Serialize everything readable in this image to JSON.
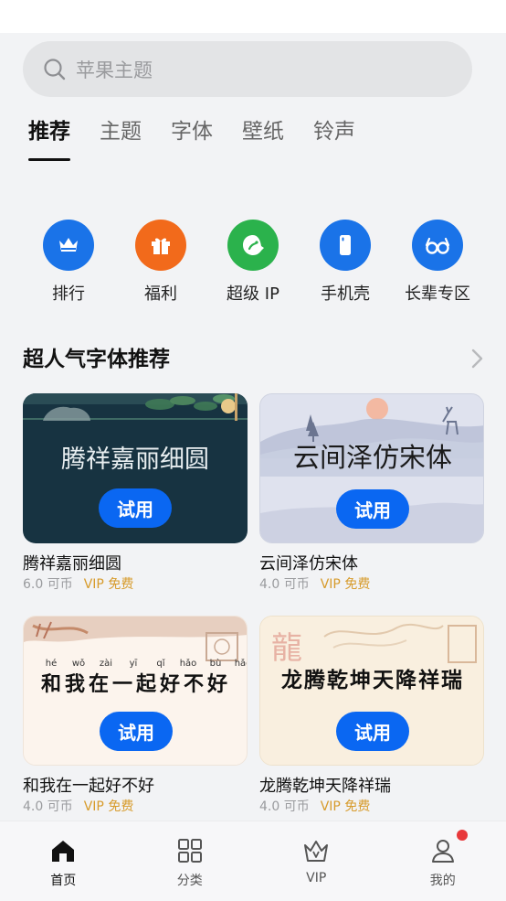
{
  "search": {
    "placeholder": "苹果主题"
  },
  "tabs": [
    {
      "label": "推荐",
      "active": true
    },
    {
      "label": "主题"
    },
    {
      "label": "字体"
    },
    {
      "label": "壁纸"
    },
    {
      "label": "铃声"
    }
  ],
  "quick": [
    {
      "label": "排行",
      "icon": "crown-icon",
      "color": "#1a73e8"
    },
    {
      "label": "福利",
      "icon": "gift-icon",
      "color": "#f26a1b"
    },
    {
      "label": "超级 IP",
      "icon": "ip-icon",
      "color": "#2bb24c"
    },
    {
      "label": "手机壳",
      "icon": "phone-case-icon",
      "color": "#1a73e8"
    },
    {
      "label": "长辈专区",
      "icon": "glasses-icon",
      "color": "#1a73e8"
    }
  ],
  "section": {
    "title": "超人气字体推荐"
  },
  "cards": [
    {
      "preview": "腾祥嘉丽细圆",
      "button": "试用",
      "name": "腾祥嘉丽细圆",
      "price": "6.0 可币",
      "vip": "VIP 免费"
    },
    {
      "preview": "云间泽仿宋体",
      "button": "试用",
      "name": "云间泽仿宋体",
      "price": "4.0 可币",
      "vip": "VIP 免费"
    },
    {
      "preview": "和我在一起好不好",
      "pinyin": [
        "hé",
        "wǒ",
        "zài",
        "yī",
        "qǐ",
        "hǎo",
        "bù",
        "hǎo"
      ],
      "button": "试用",
      "name": "和我在一起好不好",
      "price": "4.0 可币",
      "vip": "VIP 免费"
    },
    {
      "preview": "龙腾乾坤天降祥瑞",
      "button": "试用",
      "name": "龙腾乾坤天降祥瑞",
      "price": "4.0 可币",
      "vip": "VIP 免费"
    }
  ],
  "nav": [
    {
      "label": "首页",
      "icon": "home-icon",
      "active": true
    },
    {
      "label": "分类",
      "icon": "grid-icon"
    },
    {
      "label": "VIP",
      "icon": "vip-crown-icon"
    },
    {
      "label": "我的",
      "icon": "profile-icon",
      "badge": true
    }
  ]
}
